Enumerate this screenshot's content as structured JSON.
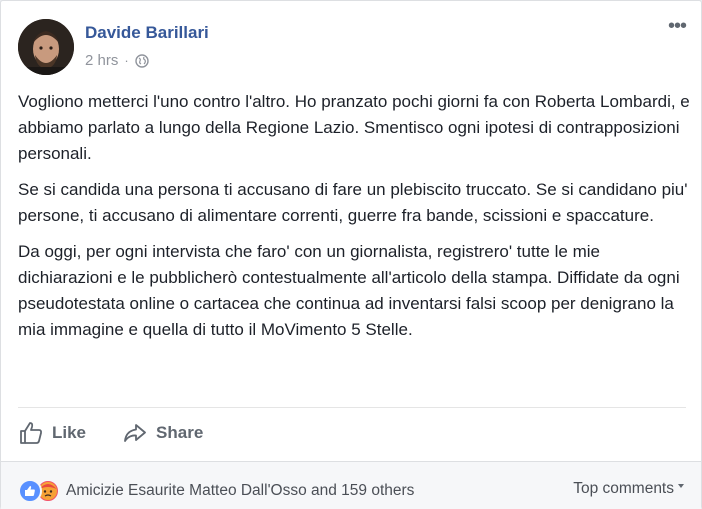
{
  "post": {
    "author": "Davide Barillari",
    "timestamp": "2 hrs",
    "separator": "·",
    "privacy_icon": "globe-icon",
    "more_icon": "more-options-icon",
    "more_label": "•••",
    "paragraphs": [
      "Vogliono metterci l'uno contro l'altro. Ho pranzato pochi giorni fa con Roberta Lombardi, e abbiamo parlato a lungo della Regione Lazio. Smentisco ogni ipotesi di contrapposizioni personali.",
      "Se si candida una persona ti accusano di fare un plebiscito truccato. Se si candidano piu' persone, ti accusano di alimentare correnti, guerre fra bande, scissioni e spaccature.",
      "Da oggi, per ogni intervista che faro' con un giornalista, registrero' tutte le mie dichiarazioni e le pubblicherò contestualmente all'articolo della stampa. Diffidate da ogni pseudotestata online o cartacea che continua ad inventarsi falsi scoop per denigrano la mia immagine e quella di tutto il MoVimento 5 Stelle."
    ]
  },
  "actions": {
    "like_label": "Like",
    "share_label": "Share"
  },
  "footer": {
    "reaction_icons": [
      "like-reaction-icon",
      "angry-reaction-icon"
    ],
    "reaction_text": "Amicizie Esaurite Matteo Dall'Osso and 159 others",
    "sort_label": "Top comments"
  },
  "colors": {
    "author": "#365899",
    "meta": "#90949c",
    "text": "#1d2129",
    "action": "#606770",
    "like_reaction": "#5890ff",
    "angry_reaction": "#f25268"
  }
}
